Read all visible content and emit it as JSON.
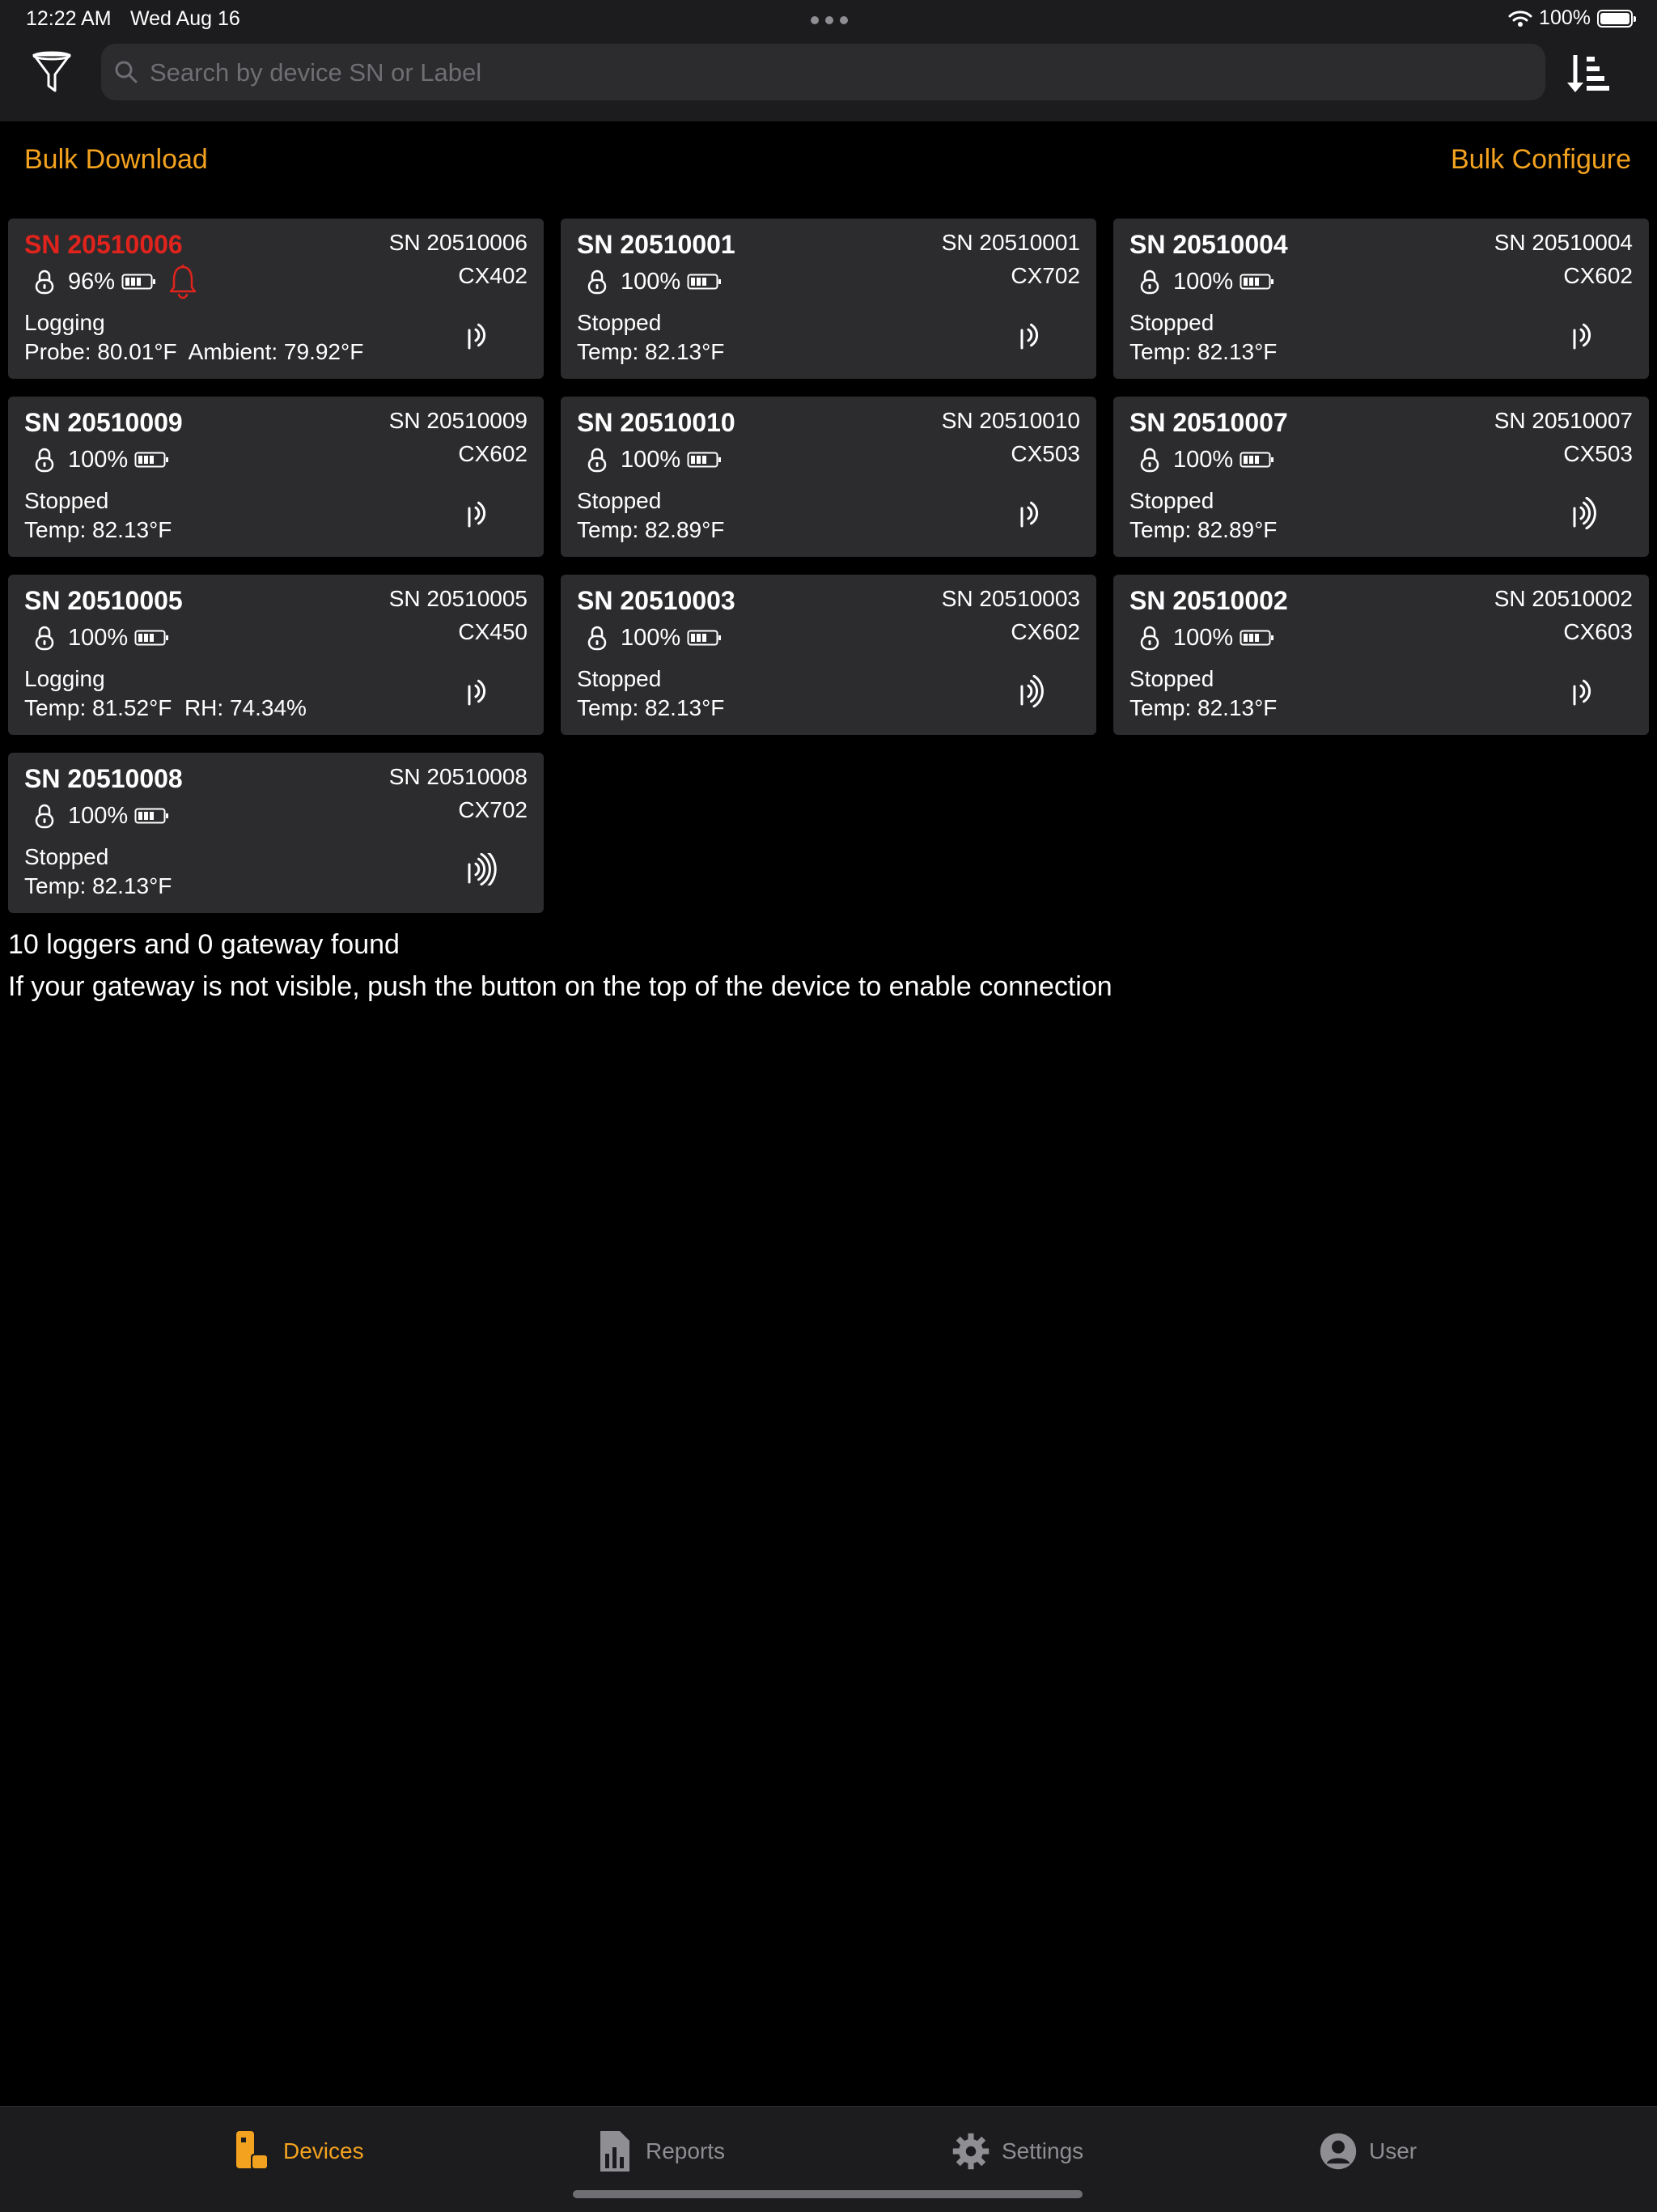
{
  "status_bar": {
    "time": "12:22 AM",
    "date": "Wed Aug 16",
    "battery": "100%"
  },
  "search": {
    "placeholder": "Search by device SN or Label",
    "value": ""
  },
  "actions": {
    "bulk_download": "Bulk Download",
    "bulk_configure": "Bulk Configure"
  },
  "devices": [
    {
      "label": "SN 20510006",
      "sn": "SN 20510006",
      "model": "CX402",
      "battery": "96%",
      "state": "Logging",
      "reading": "Probe: 80.01°F  Ambient: 79.92°F",
      "alarm": true,
      "signal_bars": 2
    },
    {
      "label": "SN 20510001",
      "sn": "SN 20510001",
      "model": "CX702",
      "battery": "100%",
      "state": "Stopped",
      "reading": "Temp: 82.13°F",
      "alarm": false,
      "signal_bars": 2
    },
    {
      "label": "SN 20510004",
      "sn": "SN 20510004",
      "model": "CX602",
      "battery": "100%",
      "state": "Stopped",
      "reading": "Temp: 82.13°F",
      "alarm": false,
      "signal_bars": 2
    },
    {
      "label": "SN 20510009",
      "sn": "SN 20510009",
      "model": "CX602",
      "battery": "100%",
      "state": "Stopped",
      "reading": "Temp: 82.13°F",
      "alarm": false,
      "signal_bars": 2
    },
    {
      "label": "SN 20510010",
      "sn": "SN 20510010",
      "model": "CX503",
      "battery": "100%",
      "state": "Stopped",
      "reading": "Temp: 82.89°F",
      "alarm": false,
      "signal_bars": 2
    },
    {
      "label": "SN 20510007",
      "sn": "SN 20510007",
      "model": "CX503",
      "battery": "100%",
      "state": "Stopped",
      "reading": "Temp: 82.89°F",
      "alarm": false,
      "signal_bars": 3
    },
    {
      "label": "SN 20510005",
      "sn": "SN 20510005",
      "model": "CX450",
      "battery": "100%",
      "state": "Logging",
      "reading": "Temp: 81.52°F  RH: 74.34%",
      "alarm": false,
      "signal_bars": 2
    },
    {
      "label": "SN 20510003",
      "sn": "SN 20510003",
      "model": "CX602",
      "battery": "100%",
      "state": "Stopped",
      "reading": "Temp: 82.13°F",
      "alarm": false,
      "signal_bars": 3
    },
    {
      "label": "SN 20510002",
      "sn": "SN 20510002",
      "model": "CX603",
      "battery": "100%",
      "state": "Stopped",
      "reading": "Temp: 82.13°F",
      "alarm": false,
      "signal_bars": 2
    },
    {
      "label": "SN 20510008",
      "sn": "SN 20510008",
      "model": "CX702",
      "battery": "100%",
      "state": "Stopped",
      "reading": "Temp: 82.13°F",
      "alarm": false,
      "signal_bars": 4
    }
  ],
  "summary": "10 loggers and 0 gateway found",
  "hint": "If your gateway is not visible, push the button on the top of the device to enable connection",
  "tabs": [
    {
      "label": "Devices",
      "icon": "devices-icon",
      "active": true
    },
    {
      "label": "Reports",
      "icon": "reports-icon",
      "active": false
    },
    {
      "label": "Settings",
      "icon": "gear-icon",
      "active": false
    },
    {
      "label": "User",
      "icon": "user-icon",
      "active": false
    }
  ],
  "colors": {
    "accent": "#f3a21f",
    "alarm": "#e0231c",
    "card": "#2c2c2e",
    "bar": "#1c1c1e"
  }
}
